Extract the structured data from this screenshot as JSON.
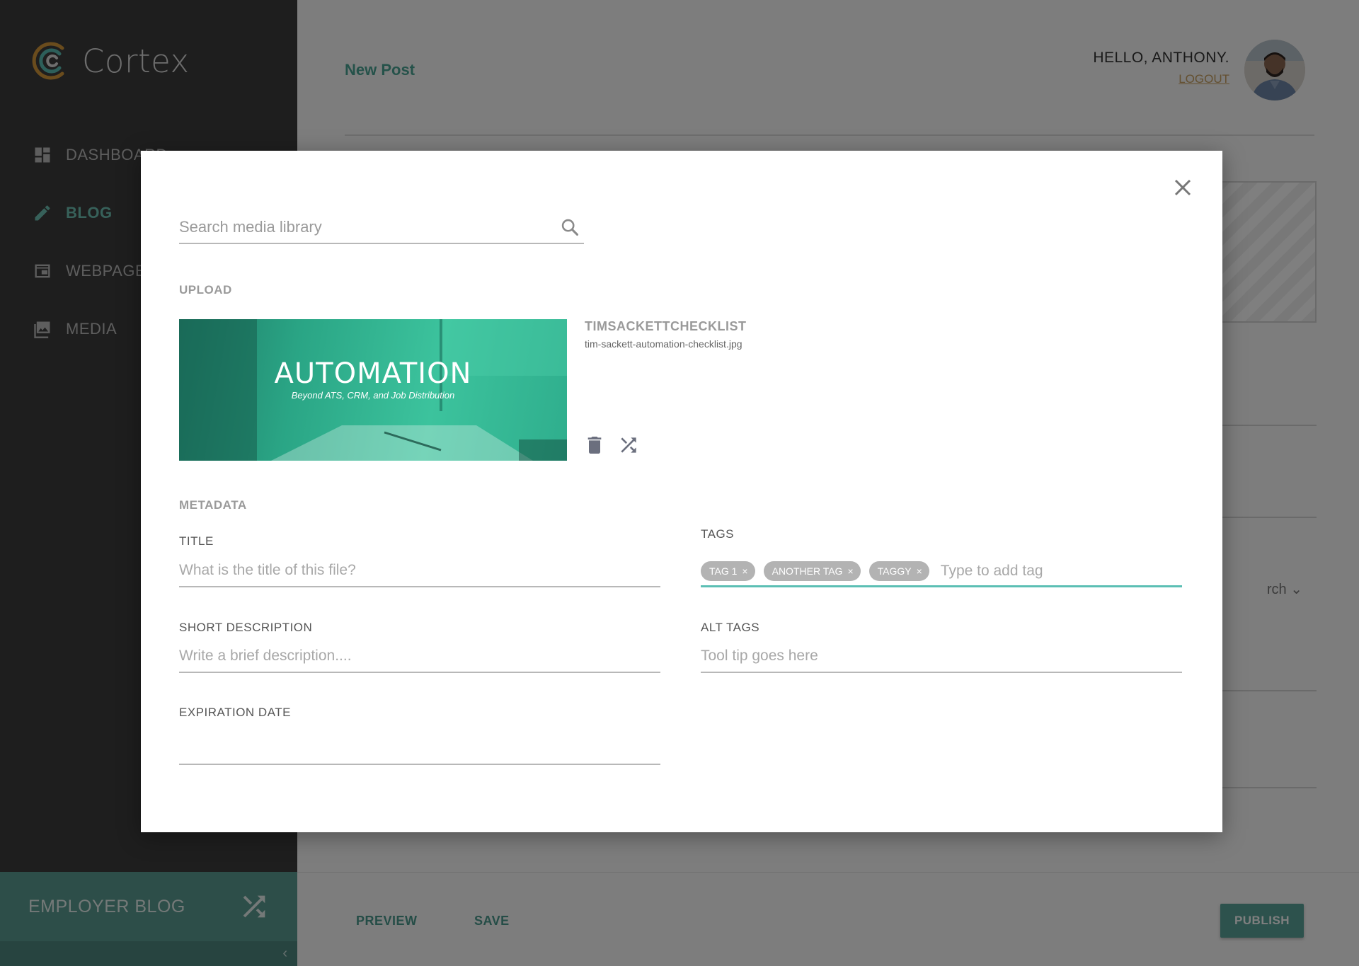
{
  "brand": {
    "name": "Cortex"
  },
  "sidebar": {
    "items": [
      {
        "label": "DASHBOARD",
        "icon": "dashboard-icon",
        "active": false
      },
      {
        "label": "BLOG",
        "icon": "pencil-icon",
        "active": true
      },
      {
        "label": "WEBPAGES",
        "icon": "webpage-icon",
        "active": false
      },
      {
        "label": "MEDIA",
        "icon": "media-icon",
        "active": false
      }
    ],
    "site_switch": {
      "label": "EMPLOYER BLOG",
      "icon": "shuffle-icon"
    },
    "collapse_icon": "‹"
  },
  "header": {
    "page_title": "New Post",
    "greeting": "HELLO, ANTHONY.",
    "logout": "LOGOUT"
  },
  "background": {
    "search_partial": "rch"
  },
  "footer": {
    "preview": "PREVIEW",
    "save": "SAVE",
    "publish": "PUBLISH"
  },
  "modal": {
    "search": {
      "placeholder": "Search media library",
      "value": ""
    },
    "upload_label": "UPLOAD",
    "file": {
      "title": "TIMSACKETTCHECKLIST",
      "filename": "tim-sackett-automation-checklist.jpg",
      "image_headline": "AUTOMATION",
      "image_subtitle": "Beyond ATS, CRM, and Job Distribution"
    },
    "metadata_label": "METADATA",
    "title_field": {
      "label": "TITLE",
      "placeholder": "What is the title of this file?"
    },
    "tags_field": {
      "label": "TAGS",
      "tags": [
        "TAG 1",
        "ANOTHER TAG",
        "TAGGY"
      ],
      "placeholder": "Type to add tag"
    },
    "short_description": {
      "label": "SHORT DESCRIPTION",
      "placeholder": "Write a brief description...."
    },
    "alt_tags": {
      "label": "ALT TAGS",
      "placeholder": "Tool tip goes here"
    },
    "expiration_date": {
      "label": "EXPIRATION DATE",
      "value": ""
    }
  },
  "colors": {
    "accent": "#5bbfb4",
    "sidebar_bg": "#3d3d3d",
    "active_nav": "#6fc3b4",
    "publish_bg": "#5aa59a"
  }
}
